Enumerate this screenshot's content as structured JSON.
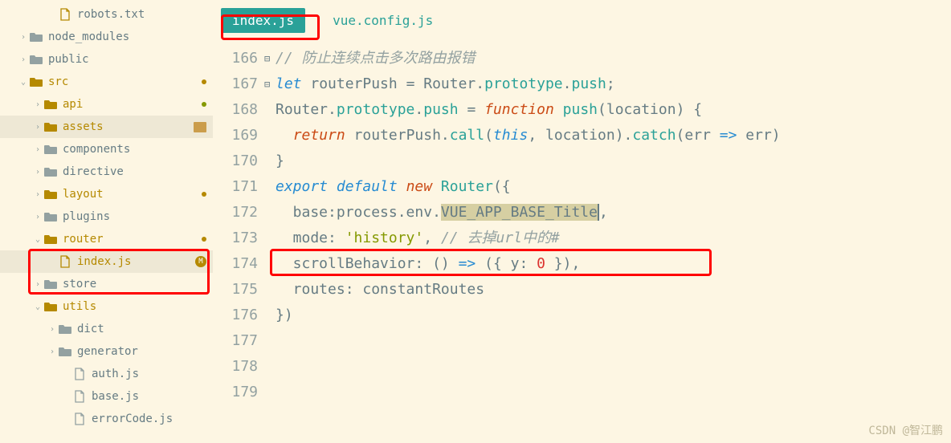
{
  "tabs": {
    "active": "index.js",
    "inactive": "vue.config.js"
  },
  "tree": [
    {
      "indent": 58,
      "arrow": "",
      "icon": "file-y",
      "label": "robots.txt",
      "cls": "",
      "badge": ""
    },
    {
      "indent": 22,
      "arrow": "›",
      "icon": "folder-closed-g",
      "label": "node_modules",
      "cls": "",
      "badge": ""
    },
    {
      "indent": 22,
      "arrow": "›",
      "icon": "folder-closed-g",
      "label": "public",
      "cls": "",
      "badge": ""
    },
    {
      "indent": 22,
      "arrow": "⌄",
      "icon": "folder-open-y",
      "label": "src",
      "cls": "orange",
      "badge": "dot"
    },
    {
      "indent": 40,
      "arrow": "›",
      "icon": "folder-closed-y",
      "label": "api",
      "cls": "orange",
      "badge": "dot-green"
    },
    {
      "indent": 40,
      "arrow": "›",
      "icon": "folder-closed-y",
      "label": "assets",
      "cls": "orange",
      "badge": "",
      "trailFolder": true,
      "selected": true
    },
    {
      "indent": 40,
      "arrow": "›",
      "icon": "folder-closed-g",
      "label": "components",
      "cls": "",
      "badge": ""
    },
    {
      "indent": 40,
      "arrow": "›",
      "icon": "folder-closed-g",
      "label": "directive",
      "cls": "",
      "badge": ""
    },
    {
      "indent": 40,
      "arrow": "›",
      "icon": "folder-closed-y",
      "label": "layout",
      "cls": "orange",
      "badge": "dot"
    },
    {
      "indent": 40,
      "arrow": "›",
      "icon": "folder-closed-g",
      "label": "plugins",
      "cls": "",
      "badge": ""
    },
    {
      "indent": 40,
      "arrow": "⌄",
      "icon": "folder-open-y",
      "label": "router",
      "cls": "orange",
      "badge": "dot"
    },
    {
      "indent": 58,
      "arrow": "",
      "icon": "file-y",
      "label": "index.js",
      "cls": "orange",
      "badge": "m",
      "selected": true
    },
    {
      "indent": 40,
      "arrow": "›",
      "icon": "folder-closed-g",
      "label": "store",
      "cls": "",
      "badge": ""
    },
    {
      "indent": 40,
      "arrow": "⌄",
      "icon": "folder-open-y",
      "label": "utils",
      "cls": "orange",
      "badge": ""
    },
    {
      "indent": 58,
      "arrow": "›",
      "icon": "folder-closed-g",
      "label": "dict",
      "cls": "",
      "badge": ""
    },
    {
      "indent": 58,
      "arrow": "›",
      "icon": "folder-closed-g",
      "label": "generator",
      "cls": "",
      "badge": ""
    },
    {
      "indent": 76,
      "arrow": "",
      "icon": "file-g",
      "label": "auth.js",
      "cls": "",
      "badge": ""
    },
    {
      "indent": 76,
      "arrow": "",
      "icon": "file-g",
      "label": "base.js",
      "cls": "",
      "badge": ""
    },
    {
      "indent": 76,
      "arrow": "",
      "icon": "file-g",
      "label": "errorCode.js",
      "cls": "",
      "badge": ""
    }
  ],
  "lines": {
    "166": "",
    "167_cm": "// 防止连续点击多次路由报错",
    "168": {
      "let": "let",
      "v": " routerPush ",
      "eq": "=",
      "r": " Router",
      "dot": ".",
      "proto": "prototype",
      "dot2": ".",
      "push": "push",
      "semi": ";"
    },
    "169": {
      "r": "Router",
      "dot": ".",
      "proto": "prototype",
      "dot2": ".",
      "push": "push",
      "sp": " ",
      "eq": "=",
      "sp2": " ",
      "fn": "function",
      "sp3": " ",
      "name": "push",
      "lp": "(",
      "arg": "location",
      "rp": ") {"
    },
    "170": {
      "ind": "  ",
      "ret": "return",
      "call": " routerPush.",
      "m": "call",
      "lp": "(",
      "this": "this",
      "c": ", location).",
      "catch": "catch",
      "lp2": "(err ",
      "arrow": "=>",
      "tail": " err)"
    },
    "171": "}",
    "172": "",
    "173": {
      "exp": "export default",
      "sp": " ",
      "new": "new",
      "sp2": " ",
      "R": "Router",
      "tail": "({"
    },
    "174": {
      "ind": "  base:process.env.",
      "sel": "VUE_APP_BASE_Title",
      "tail": ","
    },
    "175_a": "  mode: ",
    "175_s": "'history'",
    "175_c": ", ",
    "175_cm": "// 去掉url中的#",
    "176_a": "  scrollBehavior: () ",
    "176_arrow": "=>",
    "176_b": " ({ y: ",
    "176_n": "0",
    "176_c": " }),",
    "177": "  routes: constantRoutes",
    "178": "})",
    "179": ""
  },
  "gutter": [
    "166",
    "167",
    "168",
    "169",
    "170",
    "171",
    "172",
    "173",
    "174",
    "175",
    "176",
    "177",
    "178",
    "179"
  ],
  "fold": {
    "169": "⊟",
    "173": "⊟"
  },
  "watermark": "CSDN @智江鹏"
}
